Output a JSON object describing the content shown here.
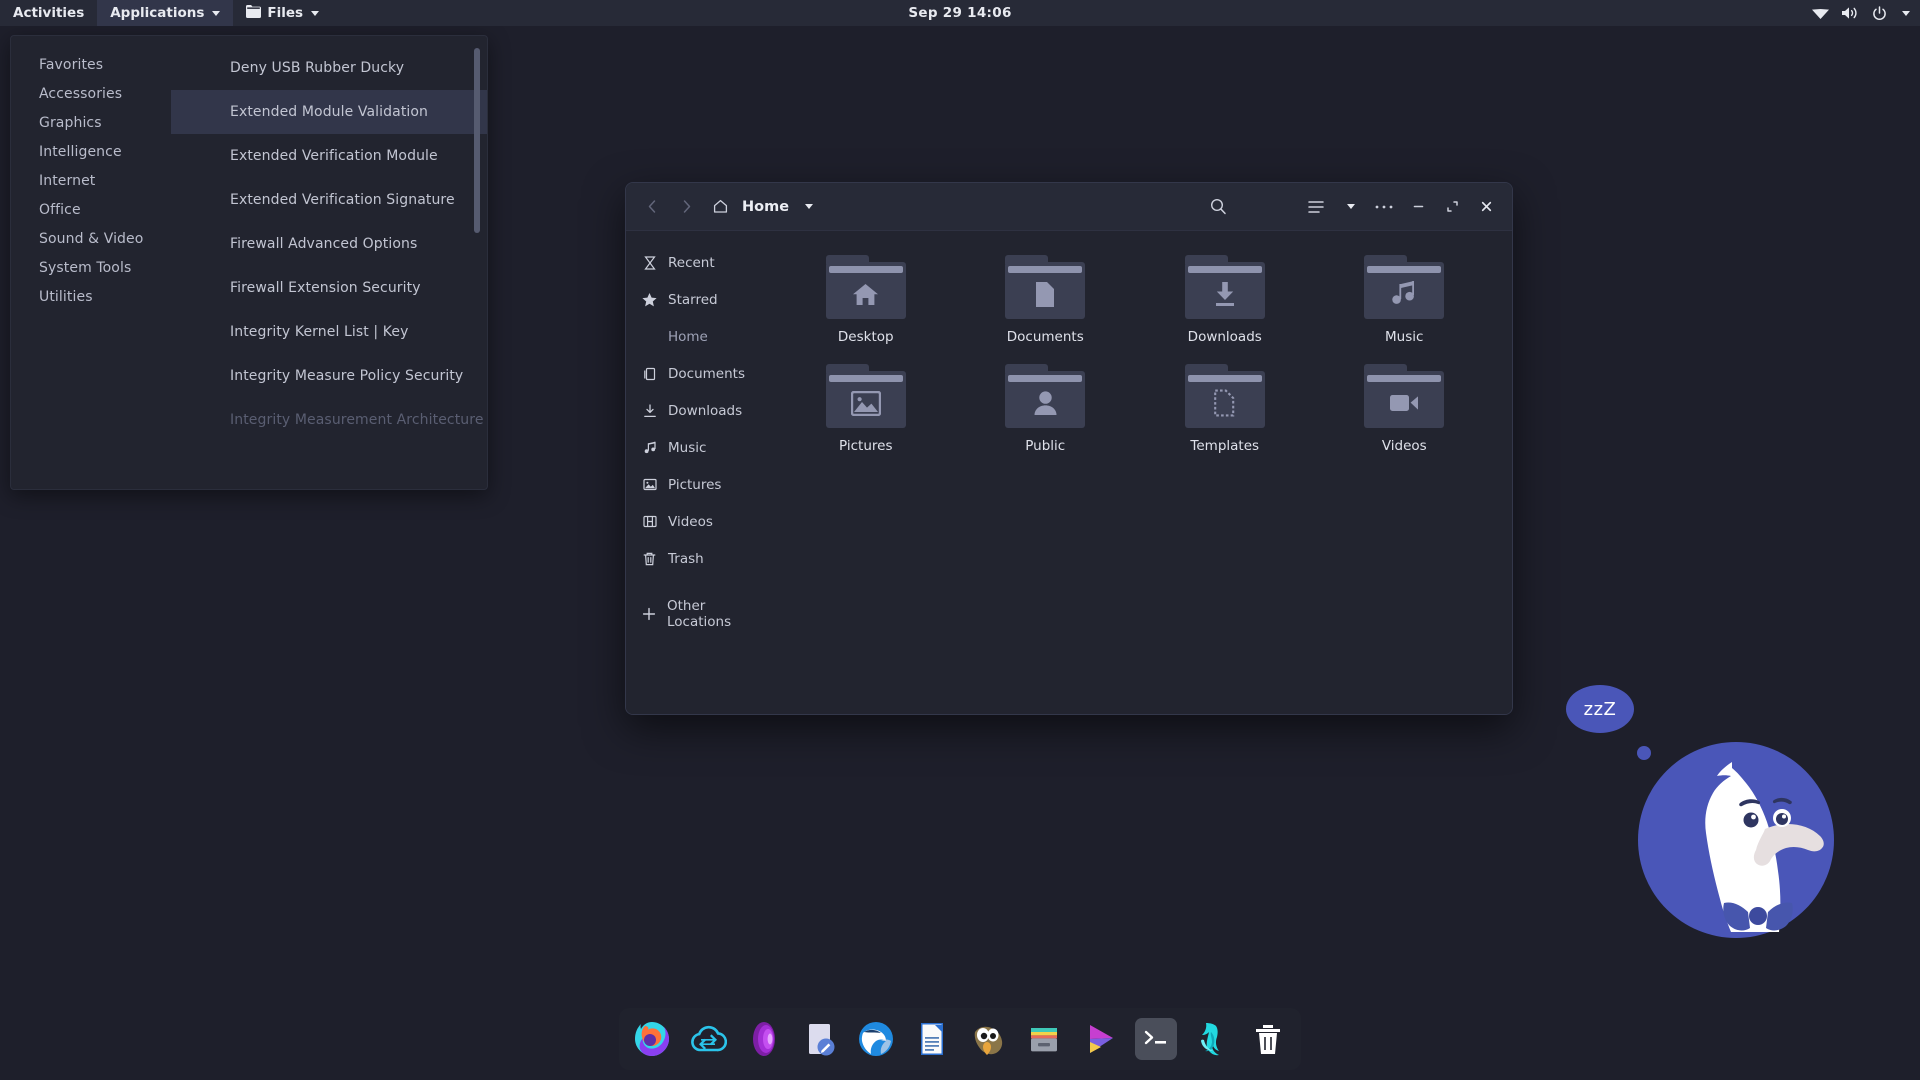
{
  "topbar": {
    "activities": "Activities",
    "applications": "Applications",
    "files": "Files",
    "clock": "Sep 29  14:06",
    "indicators": [
      {
        "name": "wifi-icon"
      },
      {
        "name": "volume-icon"
      },
      {
        "name": "power-icon"
      },
      {
        "name": "chevron-down-icon"
      }
    ]
  },
  "app_menu": {
    "categories": [
      {
        "label": "Favorites"
      },
      {
        "label": "Accessories"
      },
      {
        "label": "Graphics"
      },
      {
        "label": "Intelligence"
      },
      {
        "label": "Internet"
      },
      {
        "label": "Office"
      },
      {
        "label": "Sound & Video"
      },
      {
        "label": "System Tools"
      },
      {
        "label": "Utilities"
      }
    ],
    "items": [
      {
        "label": "Deny USB Rubber Ducky",
        "state": "normal"
      },
      {
        "label": "Extended Module Validation",
        "state": "selected"
      },
      {
        "label": "Extended Verification Module",
        "state": "normal"
      },
      {
        "label": "Extended Verification Signature",
        "state": "normal"
      },
      {
        "label": "Firewall Advanced Options",
        "state": "normal"
      },
      {
        "label": "Firewall Extension Security",
        "state": "normal"
      },
      {
        "label": "Integrity Kernel List | Key",
        "state": "normal"
      },
      {
        "label": "Integrity Measure Policy Security",
        "state": "normal"
      },
      {
        "label": "Integrity Measurement Architecture",
        "state": "faded"
      }
    ]
  },
  "file_manager": {
    "title": "Home",
    "header_buttons": [
      {
        "name": "back-button"
      },
      {
        "name": "forward-button"
      },
      {
        "name": "home-icon"
      },
      {
        "name": "path-dropdown"
      },
      {
        "name": "search-icon"
      },
      {
        "name": "view-list-icon"
      },
      {
        "name": "view-dropdown"
      },
      {
        "name": "menu-icon"
      },
      {
        "name": "minimize-button"
      },
      {
        "name": "maximize-button"
      },
      {
        "name": "close-button"
      }
    ],
    "sidebar": [
      {
        "label": "Recent",
        "icon": "recent-icon",
        "state": "normal"
      },
      {
        "label": "Starred",
        "icon": "star-icon",
        "state": "normal"
      },
      {
        "label": "Home",
        "icon": "home-icon",
        "state": "selected"
      },
      {
        "label": "Documents",
        "icon": "documents-icon",
        "state": "normal"
      },
      {
        "label": "Downloads",
        "icon": "downloads-icon",
        "state": "normal"
      },
      {
        "label": "Music",
        "icon": "music-icon",
        "state": "normal"
      },
      {
        "label": "Pictures",
        "icon": "pictures-icon",
        "state": "normal"
      },
      {
        "label": "Videos",
        "icon": "videos-icon",
        "state": "normal"
      },
      {
        "label": "Trash",
        "icon": "trash-icon",
        "state": "normal"
      },
      {
        "label": "Other Locations",
        "icon": "plus-icon",
        "state": "normal"
      }
    ],
    "files": [
      {
        "label": "Desktop",
        "glyph": "home"
      },
      {
        "label": "Documents",
        "glyph": "document"
      },
      {
        "label": "Downloads",
        "glyph": "download"
      },
      {
        "label": "Music",
        "glyph": "music"
      },
      {
        "label": "Pictures",
        "glyph": "image"
      },
      {
        "label": "Public",
        "glyph": "person"
      },
      {
        "label": "Templates",
        "glyph": "template"
      },
      {
        "label": "Videos",
        "glyph": "video"
      }
    ]
  },
  "mascot": {
    "bubble_text": "zzZ",
    "name": "duckduckgo-duck"
  },
  "dock": {
    "items": [
      {
        "name": "firefox"
      },
      {
        "name": "nextcloud-sync"
      },
      {
        "name": "tor-browser"
      },
      {
        "name": "text-editor"
      },
      {
        "name": "thunderbird"
      },
      {
        "name": "libreoffice-writer"
      },
      {
        "name": "gimp"
      },
      {
        "name": "file-archiver"
      },
      {
        "name": "media-player"
      },
      {
        "name": "terminal"
      },
      {
        "name": "system-monitor"
      },
      {
        "name": "trash"
      }
    ]
  },
  "colors": {
    "desktop_bg": "#1e1f2b",
    "panel_bg": "#272a37",
    "window_bg": "#22242f",
    "selection": "#32364a",
    "duck_blue": "#4a56b8"
  }
}
